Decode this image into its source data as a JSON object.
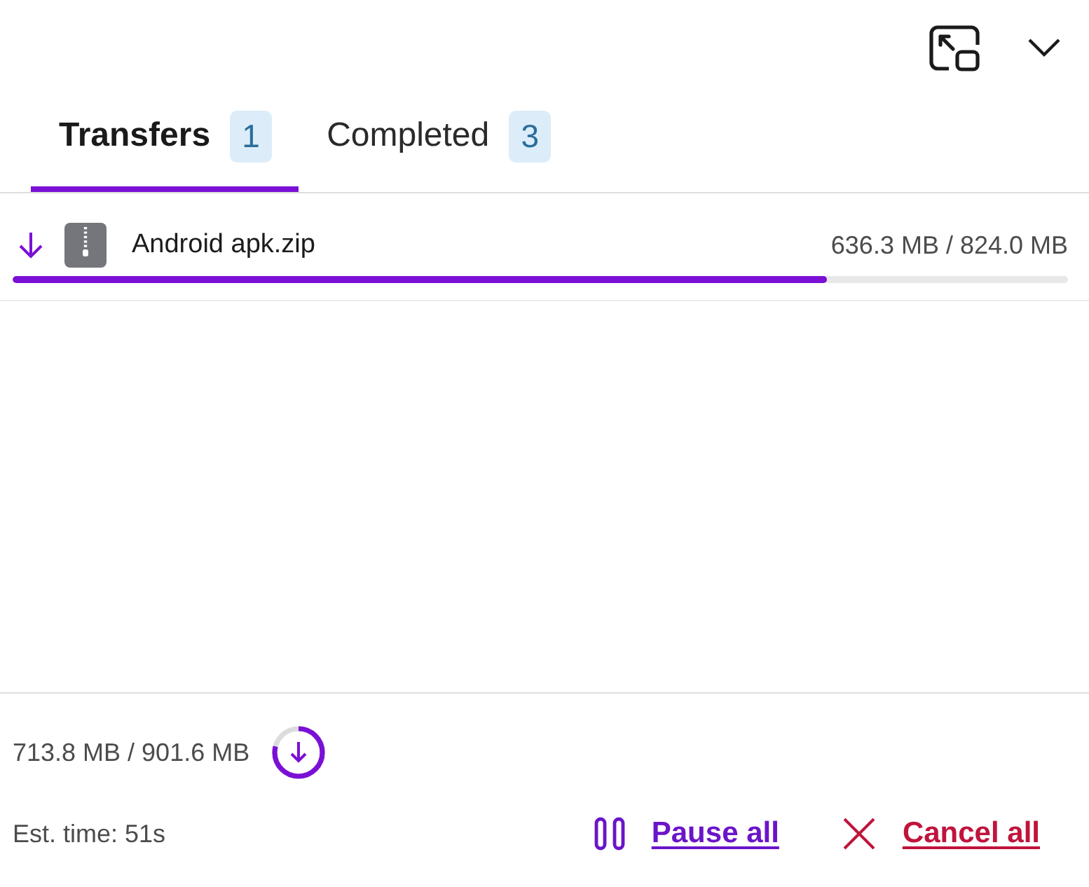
{
  "tabs": [
    {
      "label": "Transfers",
      "count": "1",
      "selected": true
    },
    {
      "label": "Completed",
      "count": "3",
      "selected": false
    }
  ],
  "transfers": [
    {
      "name": "Android apk.zip",
      "progress": "636.3 MB / 824.0 MB",
      "level": 0.772
    }
  ],
  "footer": {
    "total": "713.8 MB / 901.6 MB",
    "level": 0.79,
    "eta": "Est. time: 51s",
    "actions": [
      {
        "kind": "pause",
        "label": "Pause all"
      },
      {
        "kind": "cancel",
        "label": "Cancel all"
      }
    ]
  }
}
